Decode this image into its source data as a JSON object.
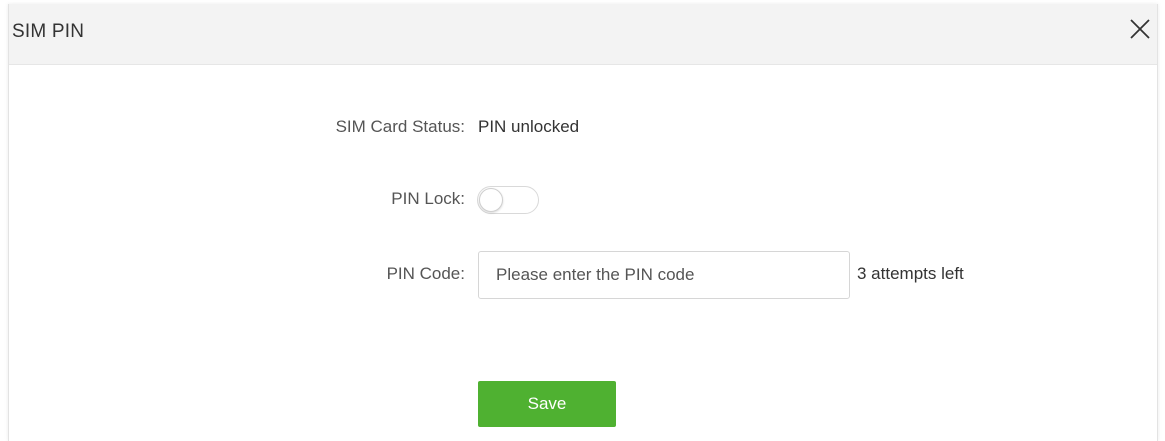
{
  "dialog": {
    "title": "SIM PIN",
    "close_icon": "close-icon"
  },
  "form": {
    "sim_status_label": "SIM Card Status:",
    "sim_status_value": "PIN unlocked",
    "pin_lock_label": "PIN Lock:",
    "pin_lock_enabled": false,
    "pin_code_label": "PIN Code:",
    "pin_code_value": "",
    "pin_code_placeholder": "Please enter the PIN code",
    "attempts_text": "3 attempts left",
    "save_label": "Save"
  },
  "colors": {
    "header_bg": "#f3f3f3",
    "save_button": "#4fb131",
    "toggle_border": "#d9d9d9"
  }
}
